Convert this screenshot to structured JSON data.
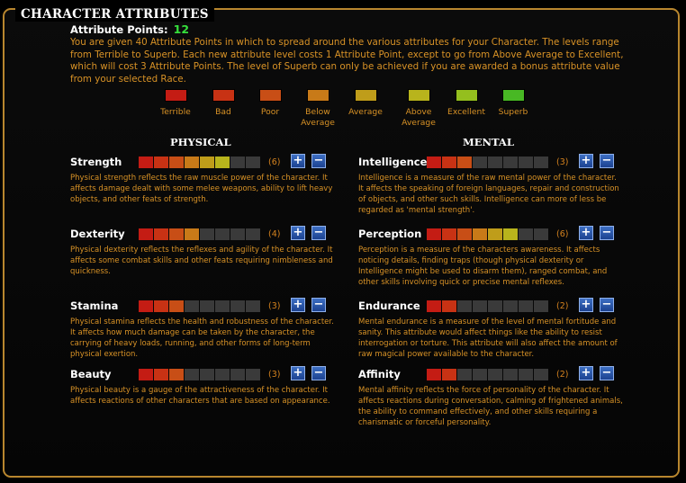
{
  "title": "CHARACTER ATTRIBUTES",
  "attribute_points": {
    "label": "Attribute Points:",
    "value": "12"
  },
  "intro": "You are given 40 Attribute Points in which to spread around the various attributes for your Character. The levels range from Terrible to Superb. Each new attribute level costs 1 Attribute Point, except to go from Above Average to Excellent, which will cost 3 Attribute Points. The level of Superb can only be achieved if you are awarded a bonus attribute value from your selected Race.",
  "levels": [
    {
      "label": "Terrible",
      "color": "#c41c14"
    },
    {
      "label": "Bad",
      "color": "#c83214"
    },
    {
      "label": "Poor",
      "color": "#c84e16"
    },
    {
      "label": "Below Average",
      "color": "#c87a18"
    },
    {
      "label": "Average",
      "color": "#bf9d1a"
    },
    {
      "label": "Above Average",
      "color": "#b8b41c"
    },
    {
      "label": "Excellent",
      "color": "#94bf1e"
    },
    {
      "label": "Superb",
      "color": "#48b824"
    }
  ],
  "empty_color": "#3a3a3a",
  "physical": {
    "heading": "PHYSICAL",
    "attributes": [
      {
        "name": "Strength",
        "level": 6,
        "value_text": "(6)",
        "plus": "+",
        "minus": "−",
        "description": "Physical strength reflects the raw muscle power of the character. It affects damage dealt with some melee weapons, ability to lift heavy objects, and other feats of strength."
      },
      {
        "name": "Dexterity",
        "level": 4,
        "value_text": "(4)",
        "plus": "+",
        "minus": "−",
        "description": "Physical dexterity reflects the reflexes and agility of the character. It affects some combat skills and other feats requiring nimbleness and quickness."
      },
      {
        "name": "Stamina",
        "level": 3,
        "value_text": "(3)",
        "plus": "+",
        "minus": "−",
        "description": "Physical stamina reflects the health and robustness of the character. It affects how much damage can be taken by the character, the carrying of heavy loads, running, and other forms of long-term physical exertion."
      },
      {
        "name": "Beauty",
        "level": 3,
        "value_text": "(3)",
        "plus": "+",
        "minus": "−",
        "description": "Physical beauty is a gauge of the attractiveness of the character. It affects reactions of other characters that are based on appearance."
      }
    ]
  },
  "mental": {
    "heading": "MENTAL",
    "attributes": [
      {
        "name": "Intelligence",
        "level": 3,
        "value_text": "(3)",
        "plus": "+",
        "minus": "−",
        "description": "Intelligence is a measure of the raw mental power of the character. It affects the speaking of foreign languages, repair and construction of objects, and other such skills. Intelligence can more of less be regarded as 'mental strength'."
      },
      {
        "name": "Perception",
        "level": 6,
        "value_text": "(6)",
        "plus": "+",
        "minus": "−",
        "description": "Perception is a measure of the characters awareness. It affects noticing details, finding traps (though physical dexterity or Intelligence might be used to disarm them), ranged combat, and other skills involving quick or precise mental reflexes."
      },
      {
        "name": "Endurance",
        "level": 2,
        "value_text": "(2)",
        "plus": "+",
        "minus": "−",
        "description": "Mental endurance is a measure of the level of mental fortitude and sanity. This attribute would affect things like the ability to resist interrogation or torture. This attribute will also affect the amount of raw magical power available to the character."
      },
      {
        "name": "Affinity",
        "level": 2,
        "value_text": "(2)",
        "plus": "+",
        "minus": "−",
        "description": "Mental affinity reflects the force of personality of the character. It affects reactions during conversation, calming of frightened animals, the ability to command effectively, and other skills requiring a charismatic or forceful personality."
      }
    ]
  }
}
